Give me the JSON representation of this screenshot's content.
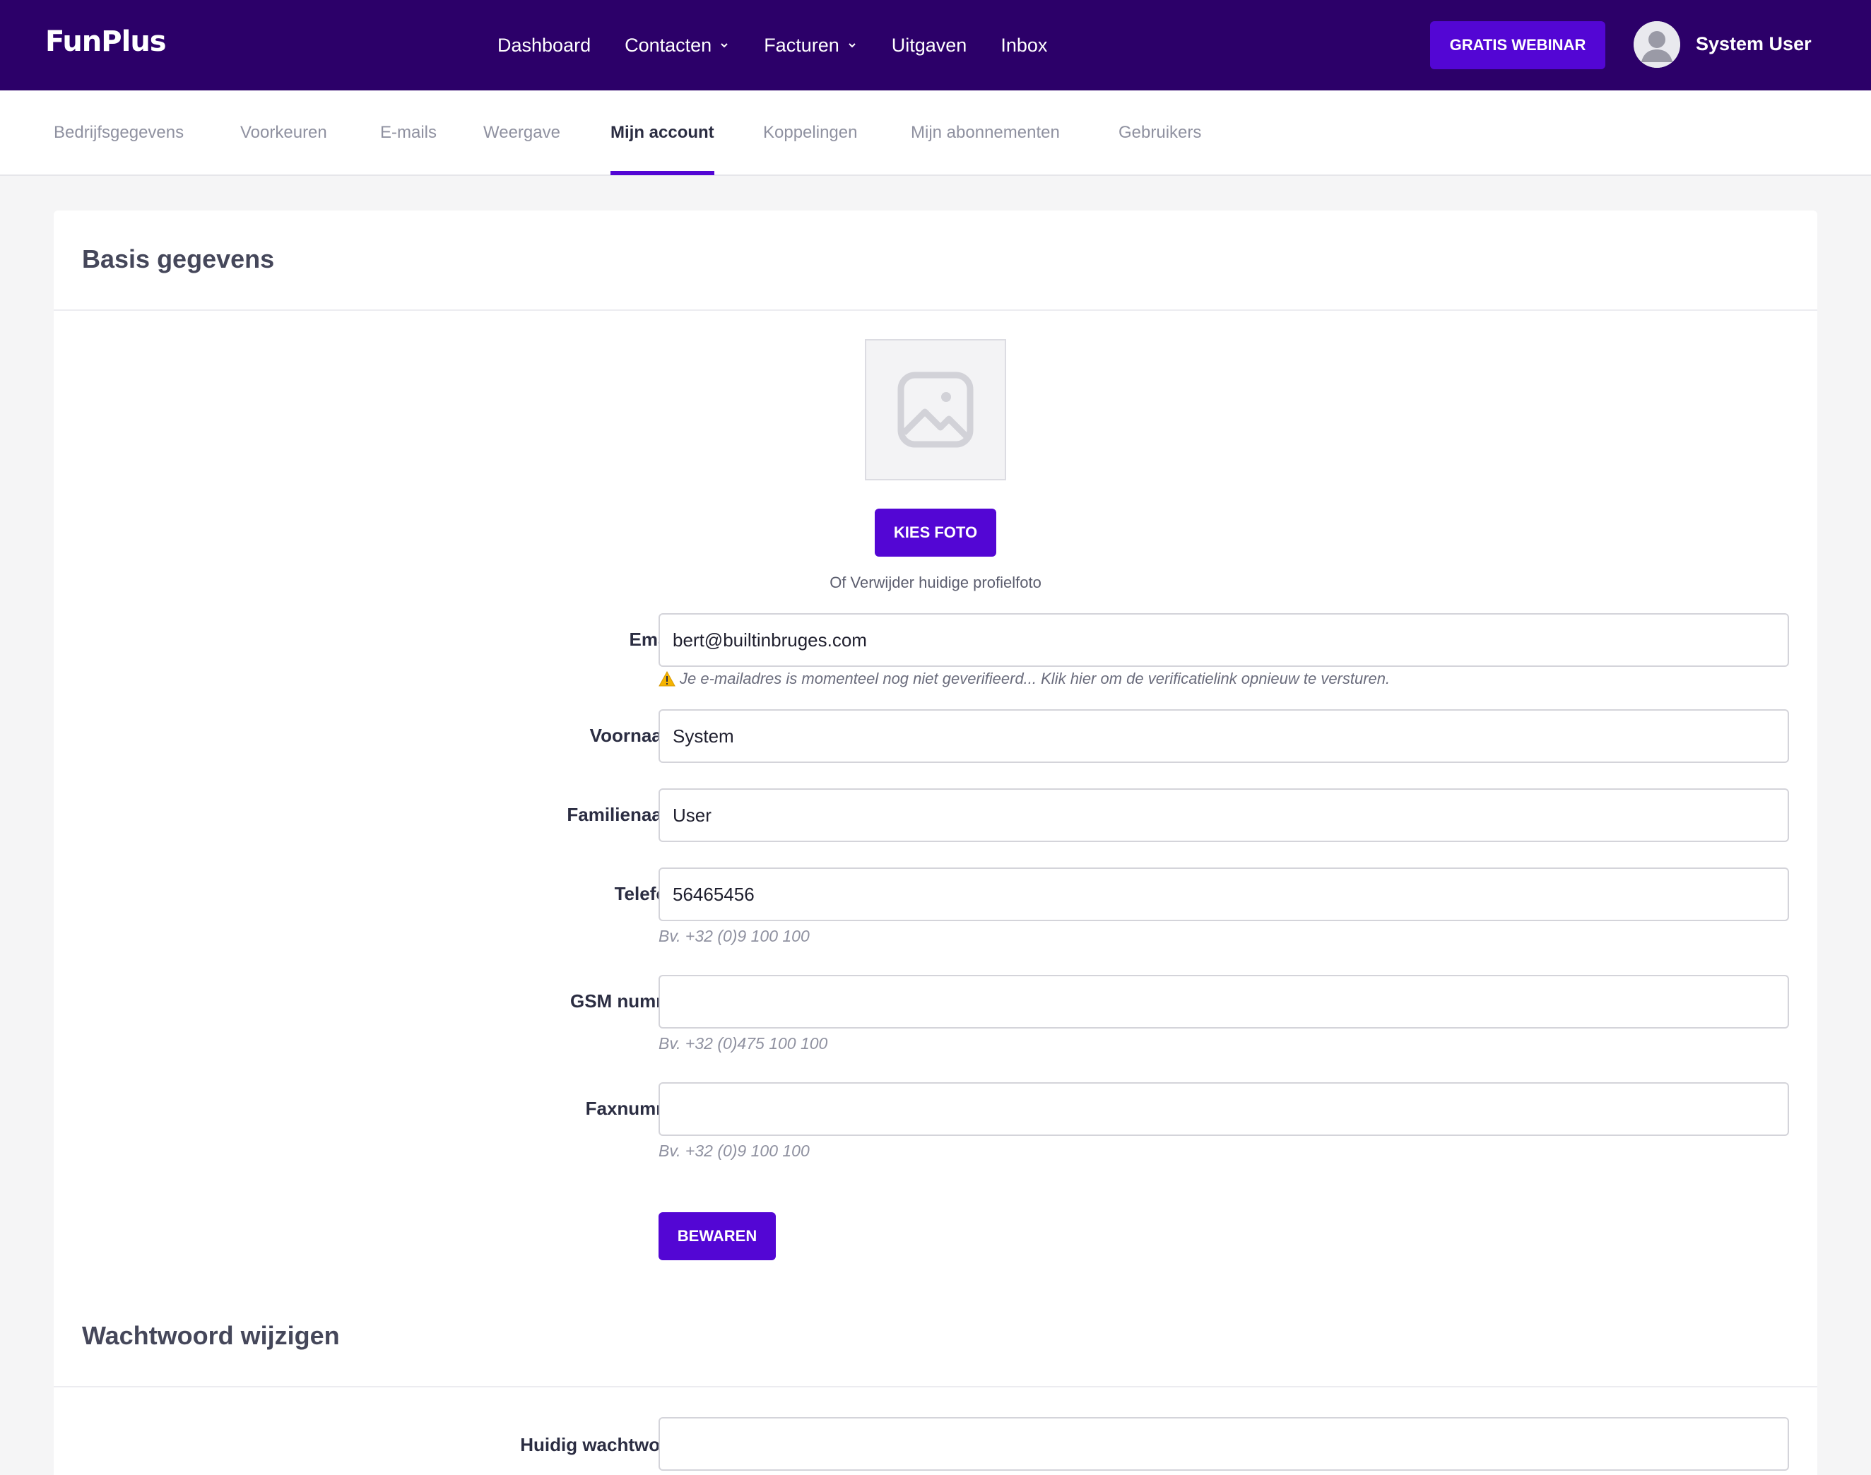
{
  "app": {
    "logo": "FunPlus"
  },
  "nav": {
    "items": [
      {
        "label": "Dashboard",
        "dropdown": false
      },
      {
        "label": "Contacten",
        "dropdown": true
      },
      {
        "label": "Facturen",
        "dropdown": true
      },
      {
        "label": "Uitgaven",
        "dropdown": false
      },
      {
        "label": "Inbox",
        "dropdown": false
      }
    ],
    "webinar_label": "GRATIS WEBINAR",
    "user_name": "System User"
  },
  "tabs": [
    {
      "label": "Bedrijfsgegevens",
      "active": false
    },
    {
      "label": "Voorkeuren",
      "active": false
    },
    {
      "label": "E-mails",
      "active": false
    },
    {
      "label": "Weergave",
      "active": false
    },
    {
      "label": "Mijn account",
      "active": true
    },
    {
      "label": "Koppelingen",
      "active": false
    },
    {
      "label": "Mijn abonnementen",
      "active": false
    },
    {
      "label": "Gebruikers",
      "active": false
    }
  ],
  "basis": {
    "title": "Basis gegevens",
    "photo_button": "KIES FOTO",
    "remove_photo": "Of Verwijder huidige profielfoto",
    "fields": {
      "email": {
        "label": "Email",
        "required": "*",
        "value": "bert@builtinbruges.com",
        "warning": "Je e-mailadres is momenteel nog niet geverifieerd... Klik hier om de verificatielink opnieuw te versturen."
      },
      "voornaam": {
        "label": "Voornaam",
        "required": "*",
        "value": "System"
      },
      "familienaam": {
        "label": "Familienaam",
        "required": "*",
        "value": "User"
      },
      "telefoon": {
        "label": "Telefoon",
        "value": "56465456",
        "hint": "Bv. +32 (0)9 100 100"
      },
      "gsm": {
        "label": "GSM nummer",
        "value": "",
        "hint": "Bv. +32 (0)475 100 100"
      },
      "fax": {
        "label": "Faxnummer",
        "value": "",
        "hint": "Bv. +32 (0)9 100 100"
      }
    },
    "save_button": "BEWAREN"
  },
  "password": {
    "title": "Wachtwoord wijzigen",
    "current_label": "Huidig wachtwoord",
    "current_value": ""
  },
  "colors": {
    "nav_bg": "#2c0069",
    "accent": "#5306d4",
    "required": "#e0243f",
    "warning": "#f5b400"
  }
}
